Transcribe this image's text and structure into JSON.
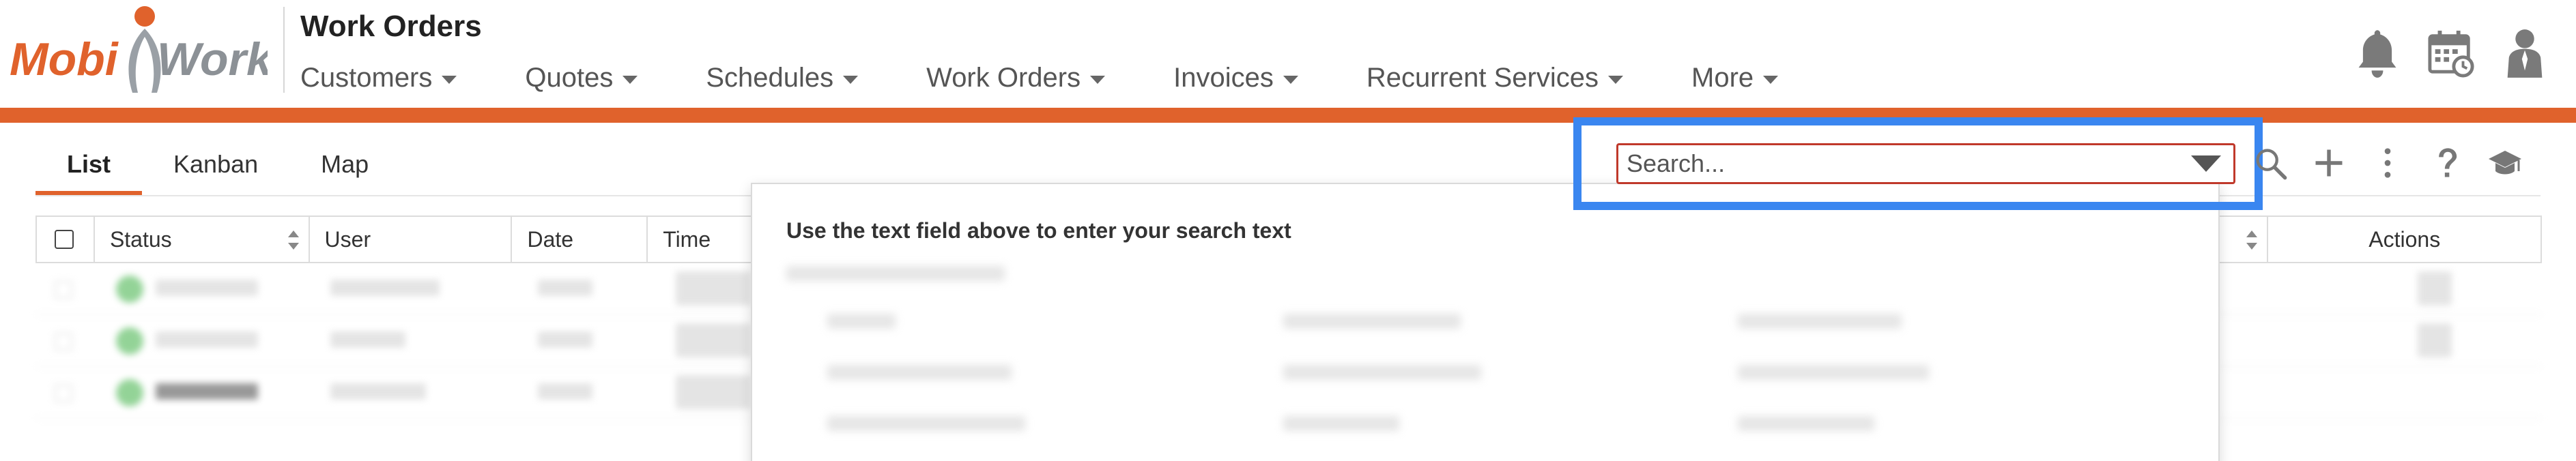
{
  "app": {
    "logo_text": "MobiWork",
    "title": "Work Orders",
    "accent_color": "#e0622c",
    "highlight_color": "#3a86f0"
  },
  "nav": {
    "items": [
      {
        "label": "Customers"
      },
      {
        "label": "Quotes"
      },
      {
        "label": "Schedules"
      },
      {
        "label": "Work Orders"
      },
      {
        "label": "Invoices"
      },
      {
        "label": "Recurrent Services"
      },
      {
        "label": "More"
      }
    ]
  },
  "header_icons": [
    "bell-icon",
    "calendar-icon",
    "user-icon"
  ],
  "tabs": [
    {
      "label": "List",
      "active": true
    },
    {
      "label": "Kanban",
      "active": false
    },
    {
      "label": "Map",
      "active": false
    }
  ],
  "search": {
    "placeholder": "Search...",
    "value": ""
  },
  "toolbar_icons": [
    "search-icon",
    "plus-icon",
    "more-vertical-icon",
    "help-icon",
    "graduation-cap-icon"
  ],
  "table": {
    "columns": [
      {
        "label": ""
      },
      {
        "label": "Status"
      },
      {
        "label": "User"
      },
      {
        "label": "Date"
      },
      {
        "label": "Time"
      },
      {
        "label": "Actions"
      }
    ]
  },
  "dropdown": {
    "hint": "Use the text field above to enter your search text"
  }
}
